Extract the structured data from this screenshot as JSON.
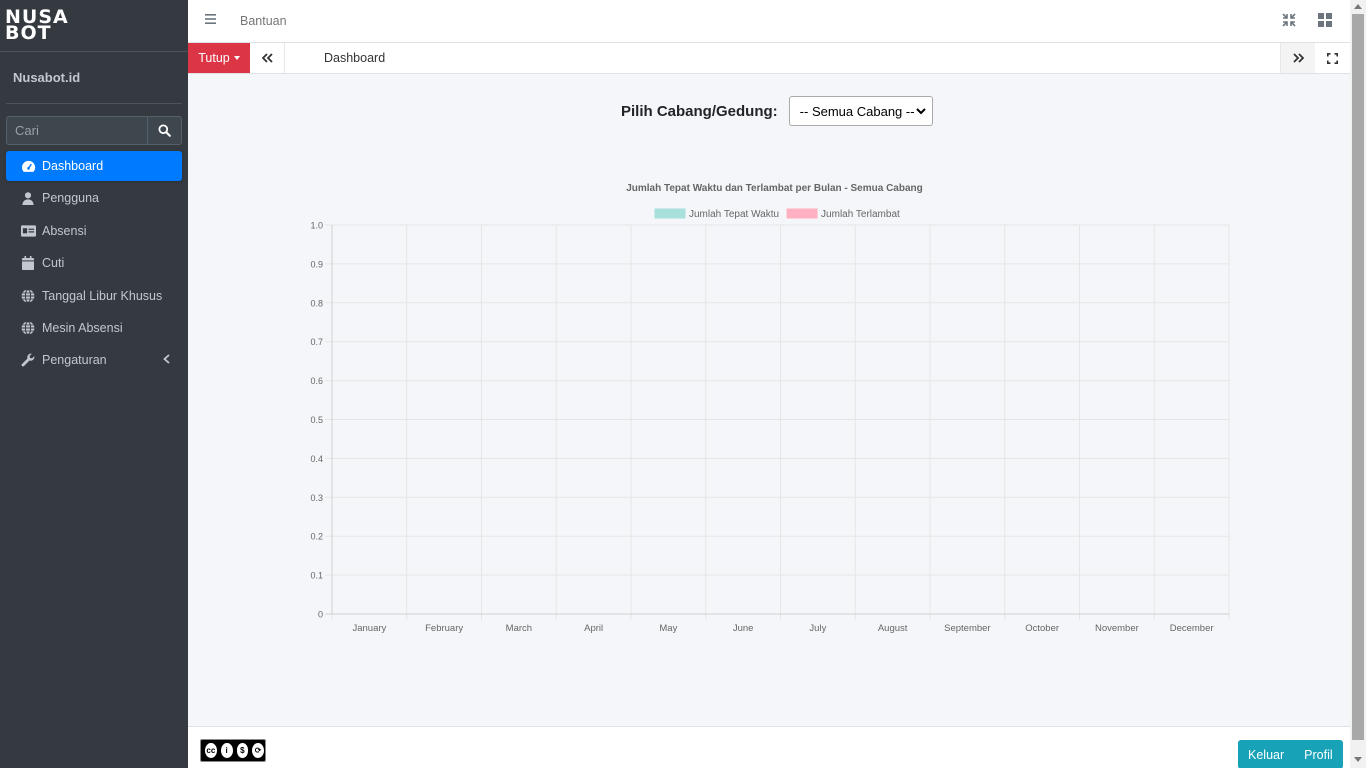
{
  "brand": {
    "logo_line1": "NUSA",
    "logo_line2": "BOT"
  },
  "user": {
    "name": "Nusabot.id"
  },
  "search": {
    "placeholder": "Cari"
  },
  "sidebar": {
    "items": [
      {
        "label": "Dashboard",
        "icon": "tachometer-icon",
        "active": true
      },
      {
        "label": "Pengguna",
        "icon": "user-icon"
      },
      {
        "label": "Absensi",
        "icon": "id-card-icon"
      },
      {
        "label": "Cuti",
        "icon": "calendar-icon"
      },
      {
        "label": "Tanggal Libur Khusus",
        "icon": "globe-icon"
      },
      {
        "label": "Mesin Absensi",
        "icon": "globe-icon"
      },
      {
        "label": "Pengaturan",
        "icon": "wrench-icon",
        "has_submenu": true
      }
    ],
    "active_color": "#007bff"
  },
  "topbar": {
    "help_label": "Bantuan"
  },
  "tabs": {
    "close_label": "Tutup",
    "active_tab": "Dashboard"
  },
  "filter": {
    "label": "Pilih Cabang/Gedung:",
    "selected": "-- Semua Cabang --"
  },
  "chart_data": {
    "type": "bar",
    "title": "Jumlah Tepat Waktu dan Terlambat per Bulan - Semua Cabang",
    "categories": [
      "January",
      "February",
      "March",
      "April",
      "May",
      "June",
      "July",
      "August",
      "September",
      "October",
      "November",
      "December"
    ],
    "series": [
      {
        "name": "Jumlah Tepat Waktu",
        "color": "#a8e0dc",
        "values": [
          0,
          0,
          0,
          0,
          0,
          0,
          0,
          0,
          0,
          0,
          0,
          0
        ]
      },
      {
        "name": "Jumlah Terlambat",
        "color": "#ffb1c1",
        "values": [
          0,
          0,
          0,
          0,
          0,
          0,
          0,
          0,
          0,
          0,
          0,
          0
        ]
      }
    ],
    "ylim": [
      0,
      1
    ],
    "yticks": [
      "0",
      "0.1",
      "0.2",
      "0.3",
      "0.4",
      "0.5",
      "0.6",
      "0.7",
      "0.8",
      "0.9",
      "1.0"
    ],
    "grid": true,
    "legend": "top"
  },
  "footer": {
    "logout_label": "Keluar",
    "profile_label": "Profil"
  },
  "colors": {
    "sidebar_bg": "#343a40",
    "danger": "#dc3545",
    "info": "#17a2b8"
  }
}
